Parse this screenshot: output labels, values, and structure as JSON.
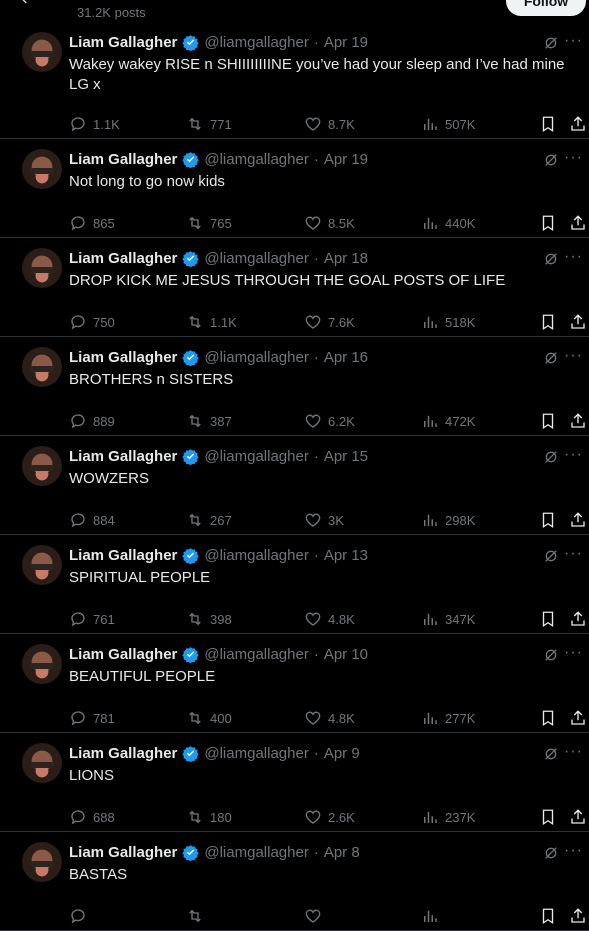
{
  "header": {
    "post_count": "31.2K posts",
    "follow_label": "Follow"
  },
  "tweets": [
    {
      "name": "Liam Gallagher",
      "handle": "@liamgallagher",
      "date": "Apr 19",
      "text": "Wakey wakey RISE n SHIIIIIIIINE you’ve had your sleep and I’ve had mine LG x",
      "replies": "1.1K",
      "reposts": "771",
      "likes": "8.7K",
      "views": "507K"
    },
    {
      "name": "Liam Gallagher",
      "handle": "@liamgallagher",
      "date": "Apr 19",
      "text": "Not long to go now kids",
      "replies": "865",
      "reposts": "765",
      "likes": "8.5K",
      "views": "440K"
    },
    {
      "name": "Liam Gallagher",
      "handle": "@liamgallagher",
      "date": "Apr 18",
      "text": "DROP KICK ME JESUS THROUGH THE GOAL POSTS OF LIFE",
      "replies": "750",
      "reposts": "1.1K",
      "likes": "7.6K",
      "views": "518K"
    },
    {
      "name": "Liam Gallagher",
      "handle": "@liamgallagher",
      "date": "Apr 16",
      "text": "BROTHERS n SISTERS",
      "replies": "889",
      "reposts": "387",
      "likes": "6.2K",
      "views": "472K"
    },
    {
      "name": "Liam Gallagher",
      "handle": "@liamgallagher",
      "date": "Apr 15",
      "text": "WOWZERS",
      "replies": "884",
      "reposts": "267",
      "likes": "3K",
      "views": "298K"
    },
    {
      "name": "Liam Gallagher",
      "handle": "@liamgallagher",
      "date": "Apr 13",
      "text": "SPIRITUAL PEOPLE",
      "replies": "761",
      "reposts": "398",
      "likes": "4.8K",
      "views": "347K"
    },
    {
      "name": "Liam Gallagher",
      "handle": "@liamgallagher",
      "date": "Apr 10",
      "text": "BEAUTIFUL PEOPLE",
      "replies": "781",
      "reposts": "400",
      "likes": "4.8K",
      "views": "277K"
    },
    {
      "name": "Liam Gallagher",
      "handle": "@liamgallagher",
      "date": "Apr 9",
      "text": "LIONS",
      "replies": "688",
      "reposts": "180",
      "likes": "2.6K",
      "views": "237K"
    },
    {
      "name": "Liam Gallagher",
      "handle": "@liamgallagher",
      "date": "Apr 8",
      "text": "BASTAS",
      "replies": "",
      "reposts": "",
      "likes": "",
      "views": ""
    }
  ],
  "icons": {
    "back": "arrow-left-icon",
    "verified": "verified-badge-icon",
    "grok": "grok-icon",
    "more": "more-dots-icon",
    "reply": "reply-icon",
    "repost": "repost-icon",
    "like": "heart-icon",
    "views": "views-chart-icon",
    "bookmark": "bookmark-icon",
    "share": "share-icon"
  },
  "colors": {
    "background": "#000000",
    "text": "#e7e9ea",
    "muted": "#71767b",
    "verified": "#1d9bf0",
    "divider": "#2f3336",
    "follow_bg": "#eff3f4"
  }
}
